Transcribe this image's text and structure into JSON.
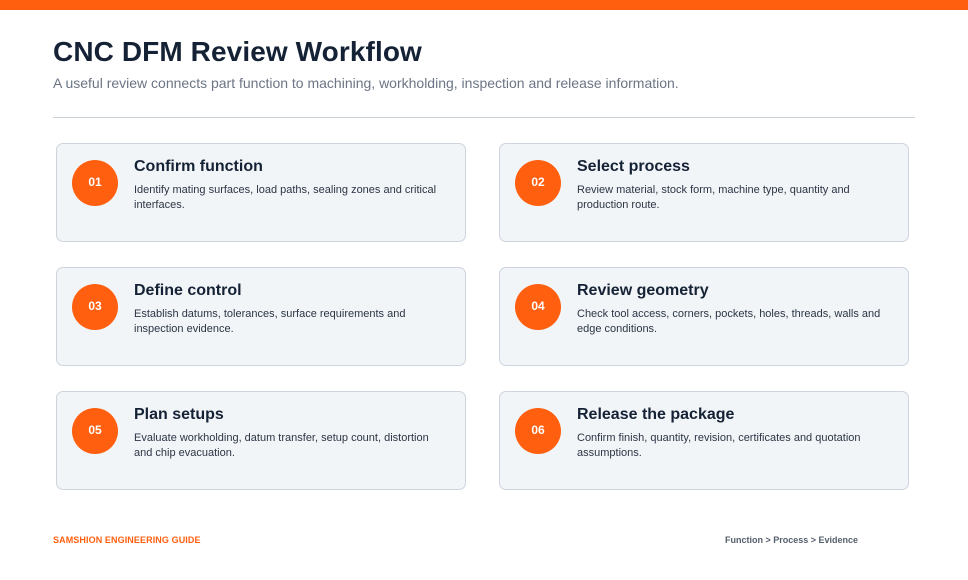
{
  "header": {
    "title": "CNC DFM Review Workflow",
    "subtitle": "A useful review connects part function to machining, workholding, inspection and release information."
  },
  "steps": [
    {
      "number": "01",
      "title": "Confirm function",
      "description": "Identify mating surfaces, load paths, sealing zones and critical interfaces."
    },
    {
      "number": "02",
      "title": "Select process",
      "description": "Review material, stock form, machine type, quantity and production route."
    },
    {
      "number": "03",
      "title": "Define control",
      "description": "Establish datums, tolerances, surface requirements and inspection evidence."
    },
    {
      "number": "04",
      "title": "Review geometry",
      "description": "Check tool access, corners, pockets, holes, threads, walls and edge conditions."
    },
    {
      "number": "05",
      "title": "Plan setups",
      "description": "Evaluate workholding, datum transfer, setup count, distortion and chip evacuation."
    },
    {
      "number": "06",
      "title": "Release the package",
      "description": "Confirm finish, quantity, revision, certificates and quotation assumptions."
    }
  ],
  "footer": {
    "brand": "SAMSHION ENGINEERING GUIDE",
    "flow": "Function > Process > Evidence"
  },
  "colors": {
    "accent": "#ff5f0f",
    "title": "#152235",
    "card_background": "#f2f5f8",
    "card_border": "#cdd4dc"
  }
}
